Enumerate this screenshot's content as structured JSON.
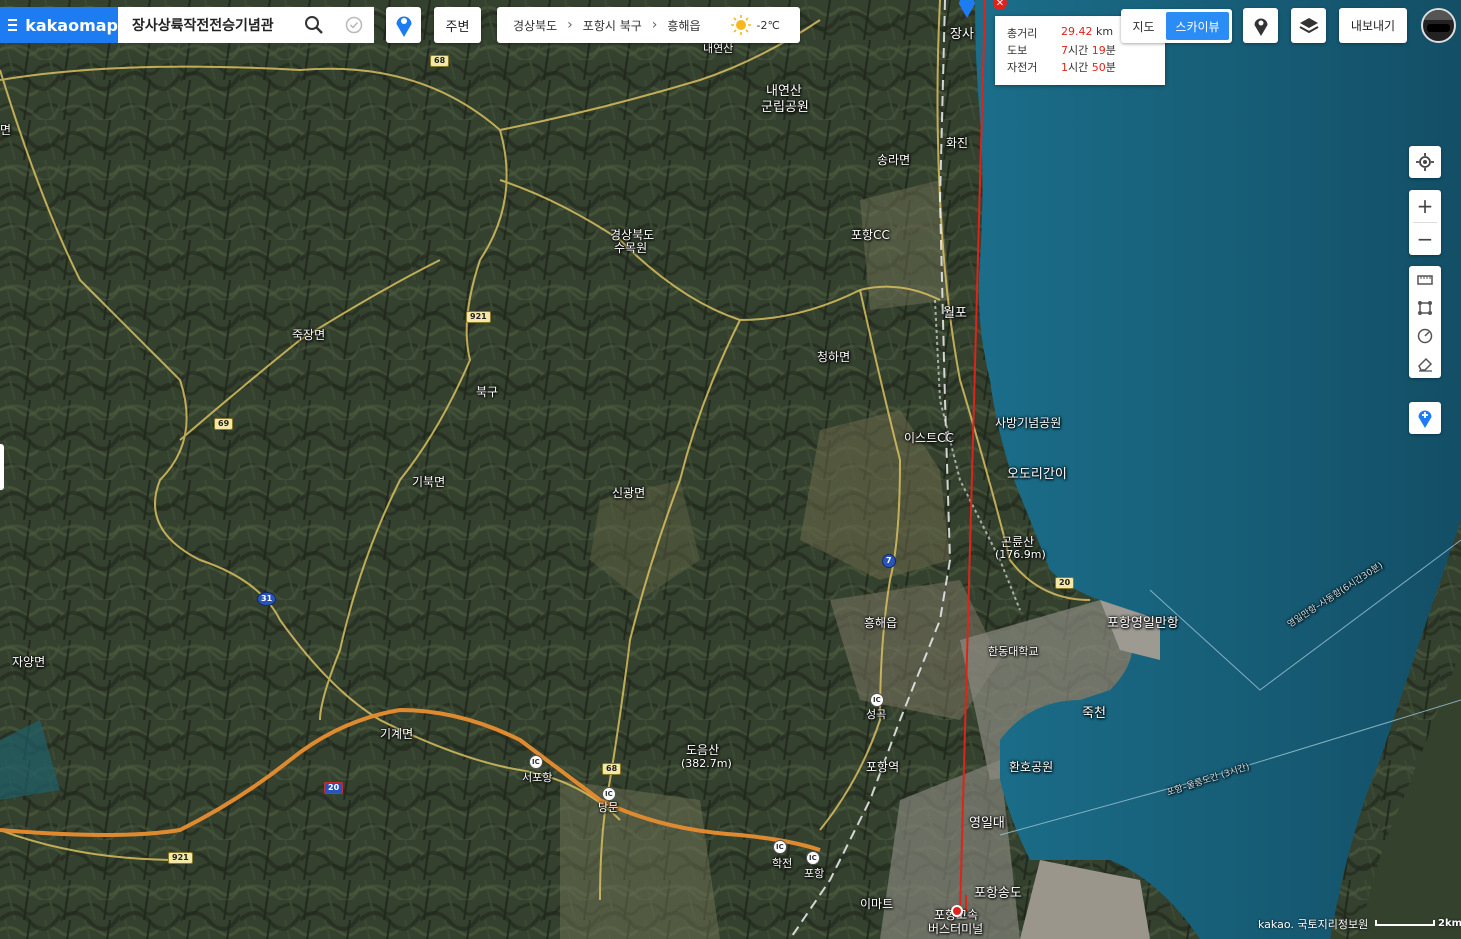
{
  "app": {
    "logo": "kakaomap"
  },
  "search": {
    "value": "장사상륙작전전승기념관"
  },
  "toolbar": {
    "nearby_label": "주변",
    "weather_temp": "-2℃"
  },
  "breadcrumb": {
    "items": [
      "경상북도",
      "포항시 북구",
      "흥해읍"
    ]
  },
  "distance": {
    "total_label": "총거리",
    "total_value": "29.42",
    "total_unit": "km",
    "walk_label": "도보",
    "walk_h": "7",
    "walk_h_unit": "시간",
    "walk_m": "19",
    "walk_m_unit": "분",
    "bike_label": "자전거",
    "bike_h": "1",
    "bike_h_unit": "시간",
    "bike_m": "50",
    "bike_m_unit": "분"
  },
  "maptype": {
    "map_label": "지도",
    "sky_label": "스카이뷰"
  },
  "export": {
    "label": "내보내기"
  },
  "colors": {
    "brand": "#1e7cf2",
    "route": "#e0231a",
    "sea": "#1a5a7a"
  },
  "labels": {
    "jangsa": "장사",
    "hwajin": "화진",
    "songra": "송라면",
    "naeyeonsan": "내연산",
    "naeyeonsan2": "군립공원",
    "naeyeonsan_top": "내연산",
    "pohangcc": "포항CC",
    "arboretum1": "경상북도",
    "arboretum2": "수목원",
    "wolpo": "월포",
    "cheongha": "청하면",
    "eastercc": "이스트CC",
    "saban": "사방기념공원",
    "odori": "오도리간이",
    "gonryun": "곤륜산",
    "gonryun_h": "(176.9m)",
    "jukjang": "죽장면",
    "bukgu": "북구",
    "gibuk": "기북면",
    "singwang": "신광면",
    "heunghae": "흥해읍",
    "handong": "한동대학교",
    "yeongilport": "포항영일만항",
    "jukcheon": "죽천",
    "pohangstation": "포항역",
    "hwanho": "환호공원",
    "yeongildae": "영일대",
    "songdo": "포항송도",
    "emart": "이마트",
    "terminal1": "포항고속",
    "terminal2": "버스터미널",
    "doeum": "도음산",
    "doeum_h": "(382.7m)",
    "gigye": "기계면",
    "seopohang": "서포항",
    "dangun": "당문",
    "hakjeon": "학전",
    "pohang": "포항",
    "jayang": "자양면",
    "myeon_left": "면",
    "seong": "성곡",
    "ferry1": "영일만항–사동항(6시간30분)",
    "ferry2": "포항–울릉도간 (3시간)",
    "copyright": "kakao. 국토지리정보원",
    "scale": "2km"
  },
  "shields": {
    "r68": "68",
    "r921": "921",
    "r69": "69",
    "r31": "31",
    "r7": "7",
    "r20": "20",
    "r20b": "20",
    "r68b": "68",
    "r921b": "921",
    "ic": "IC"
  }
}
